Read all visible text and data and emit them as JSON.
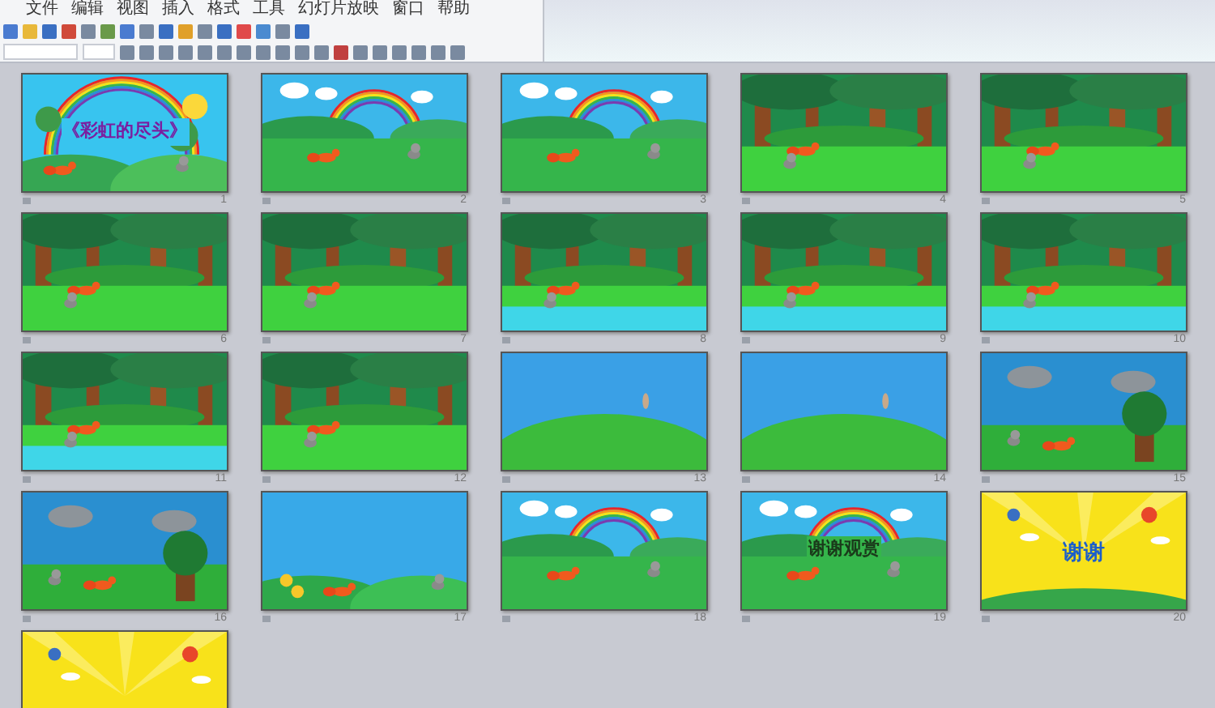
{
  "menu": [
    "文件",
    "编辑",
    "视图",
    "插入",
    "格式",
    "工具",
    "幻灯片放映",
    "窗口",
    "帮助"
  ],
  "slides": [
    {
      "number": "1",
      "kind": "rainbow-title",
      "title": "《彩虹的尽头》"
    },
    {
      "number": "2",
      "kind": "rainbow"
    },
    {
      "number": "3",
      "kind": "rainbow"
    },
    {
      "number": "4",
      "kind": "forest"
    },
    {
      "number": "5",
      "kind": "forest"
    },
    {
      "number": "6",
      "kind": "forest"
    },
    {
      "number": "7",
      "kind": "forest"
    },
    {
      "number": "8",
      "kind": "pond"
    },
    {
      "number": "9",
      "kind": "pond"
    },
    {
      "number": "10",
      "kind": "pond"
    },
    {
      "number": "11",
      "kind": "pond"
    },
    {
      "number": "12",
      "kind": "forest"
    },
    {
      "number": "13",
      "kind": "hill"
    },
    {
      "number": "14",
      "kind": "hill"
    },
    {
      "number": "15",
      "kind": "storm"
    },
    {
      "number": "16",
      "kind": "storm"
    },
    {
      "number": "17",
      "kind": "sky"
    },
    {
      "number": "18",
      "kind": "rainbow"
    },
    {
      "number": "19",
      "kind": "rainbow",
      "title": "谢谢观赏"
    },
    {
      "number": "20",
      "kind": "yellow",
      "title": "谢谢"
    },
    {
      "kind": "yellow"
    }
  ]
}
